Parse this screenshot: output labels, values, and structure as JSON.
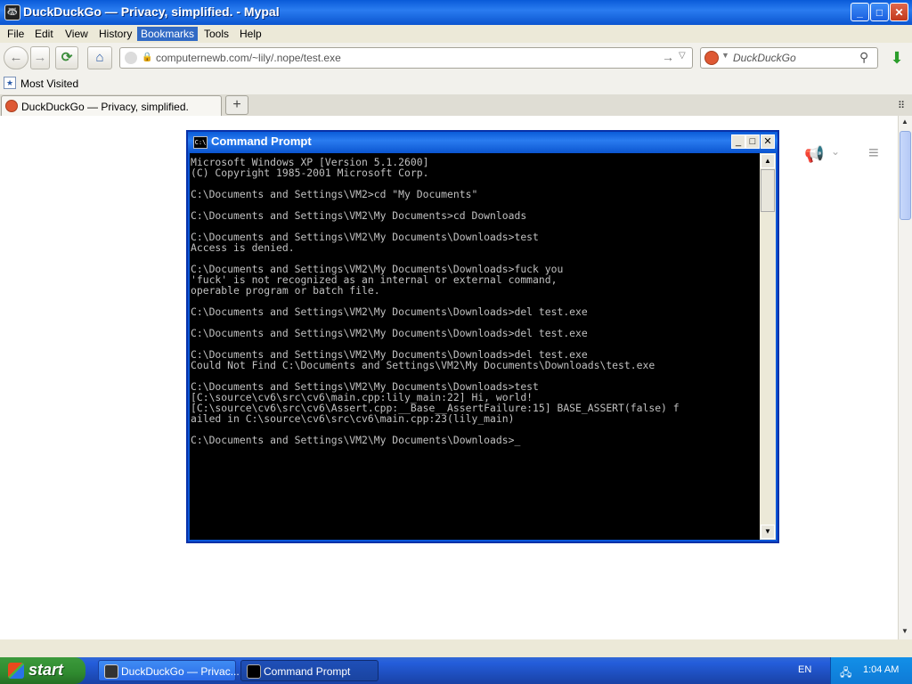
{
  "window": {
    "title": "DuckDuckGo — Privacy, simplified. - Mypal",
    "controls": {
      "minimize": "_",
      "maximize": "□",
      "close": "✕"
    }
  },
  "menu": [
    "File",
    "Edit",
    "View",
    "History",
    "Bookmarks",
    "Tools",
    "Help"
  ],
  "menu_active": "Bookmarks",
  "nav": {
    "back_icon": "←",
    "forward_icon": "→",
    "reload_icon": "⟳",
    "home_icon": "⌂",
    "url": "computernewb.com/~lily/.nope/test.exe",
    "go_icon": "→",
    "dropdown_icon": "▽"
  },
  "search": {
    "placeholder": "DuckDuckGo",
    "engine_icon": "duckduckgo-icon"
  },
  "download_icon": "⬇",
  "bookmarks": {
    "most_visited": "Most Visited"
  },
  "tabs": [
    {
      "label": "DuckDuckGo — Privacy, simplified."
    }
  ],
  "new_tab": "+",
  "page": {
    "megaphone_icon": "📢",
    "chevron": "⌄",
    "menu_icon": "≡"
  },
  "cmd": {
    "title": "Command Prompt",
    "icon_text": "C:\\",
    "controls": {
      "minimize": "_",
      "maximize": "□",
      "close": "✕"
    },
    "output": "Microsoft Windows XP [Version 5.1.2600]\n(C) Copyright 1985-2001 Microsoft Corp.\n\nC:\\Documents and Settings\\VM2>cd \"My Documents\"\n\nC:\\Documents and Settings\\VM2\\My Documents>cd Downloads\n\nC:\\Documents and Settings\\VM2\\My Documents\\Downloads>test\nAccess is denied.\n\nC:\\Documents and Settings\\VM2\\My Documents\\Downloads>fuck you\n'fuck' is not recognized as an internal or external command,\noperable program or batch file.\n\nC:\\Documents and Settings\\VM2\\My Documents\\Downloads>del test.exe\n\nC:\\Documents and Settings\\VM2\\My Documents\\Downloads>del test.exe\n\nC:\\Documents and Settings\\VM2\\My Documents\\Downloads>del test.exe\nCould Not Find C:\\Documents and Settings\\VM2\\My Documents\\Downloads\\test.exe\n\nC:\\Documents and Settings\\VM2\\My Documents\\Downloads>test\n[C:\\source\\cv6\\src\\cv6\\main.cpp:lily_main:22] Hi, world!\n[C:\\source\\cv6\\src\\cv6\\Assert.cpp:__Base__AssertFailure:15] BASE_ASSERT(false) f\nailed in C:\\source\\cv6\\src\\cv6\\main.cpp:23(lily_main)\n\nC:\\Documents and Settings\\VM2\\My Documents\\Downloads>_"
  },
  "taskbar": {
    "start": "start",
    "tasks": [
      {
        "label": "DuckDuckGo — Privac..."
      },
      {
        "label": "Command Prompt"
      }
    ],
    "lang": "EN",
    "clock": "1:04 AM"
  },
  "colors": {
    "xp_blue": "#0a5bd8",
    "start_green": "#2f8a2f",
    "console_bg": "#000000",
    "console_fg": "#c0c0c0",
    "ddg_orange": "#de5833"
  }
}
